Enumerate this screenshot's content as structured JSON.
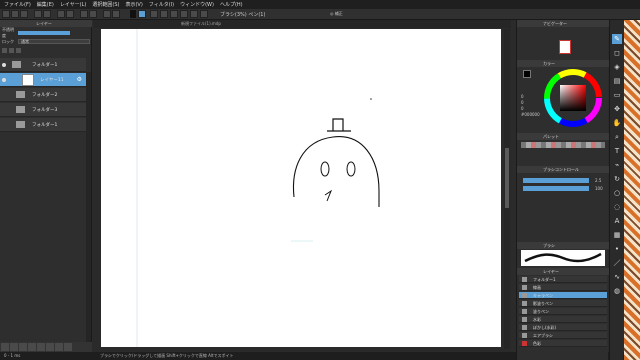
{
  "menu": [
    "ファイル(F)",
    "編集(E)",
    "レイヤー(L)",
    "選択範囲(S)",
    "表示(V)",
    "フィルタ(I)",
    "ウィンドウ(W)",
    "ヘルプ(H)"
  ],
  "toolbar": {
    "text": "ブラシ(3%)  ペン(1)",
    "right_text": "◎ 補正"
  },
  "left_panel": {
    "title": "レイヤー",
    "blend_label": "不透明度",
    "blend_mode": "通常",
    "lock_label": "ロック",
    "layers": [
      {
        "name": "フォルダー1",
        "type": "folder",
        "selected": false
      },
      {
        "name": "レイヤー11",
        "type": "layer",
        "selected": true
      },
      {
        "name": "フォルダー2",
        "type": "folder",
        "selected": false
      },
      {
        "name": "フォルダー3",
        "type": "folder",
        "selected": false
      },
      {
        "name": "フォルダー1",
        "type": "folder",
        "selected": false
      }
    ]
  },
  "canvas": {
    "tab_title": "新規ファイル(1).mdp"
  },
  "status": {
    "left": "0 - 1 ms",
    "center": "ブラシでクリック/ドラッグして描画 Shift+クリックで直線 Altでスポイト"
  },
  "right_panel": {
    "navigator_title": "ナビゲーター",
    "color_title": "カラー",
    "color_values": [
      "0",
      "0",
      "0",
      "#000000"
    ],
    "palette_title": "パレット",
    "brush_title": "ブラシコントロール",
    "brush_size": "2.5",
    "brush_opacity": "100",
    "brush_preview_title": "ブラシ",
    "layers_title": "レイヤー",
    "layers": [
      {
        "name": "フォルダー1",
        "selected": false
      },
      {
        "name": "線画",
        "selected": false
      },
      {
        "name": "キャラペン",
        "selected": true
      },
      {
        "name": "影塗りペン",
        "selected": false
      },
      {
        "name": "塗りペン",
        "selected": false
      },
      {
        "name": "水彩",
        "selected": false
      },
      {
        "name": "ぼかし(水彩)",
        "selected": false
      },
      {
        "name": "エアブラシ",
        "selected": false
      },
      {
        "name": "色彩",
        "selected": false
      }
    ]
  },
  "colors": {
    "accent": "#5aa0d6",
    "panel": "#2e2e2e",
    "canvas": "#ffffff"
  },
  "tools": [
    "pen-icon",
    "eraser-icon",
    "fill-icon",
    "gradient-icon",
    "select-icon",
    "move-icon",
    "hand-icon",
    "zoom-icon",
    "text-icon",
    "eyedropper-icon"
  ]
}
